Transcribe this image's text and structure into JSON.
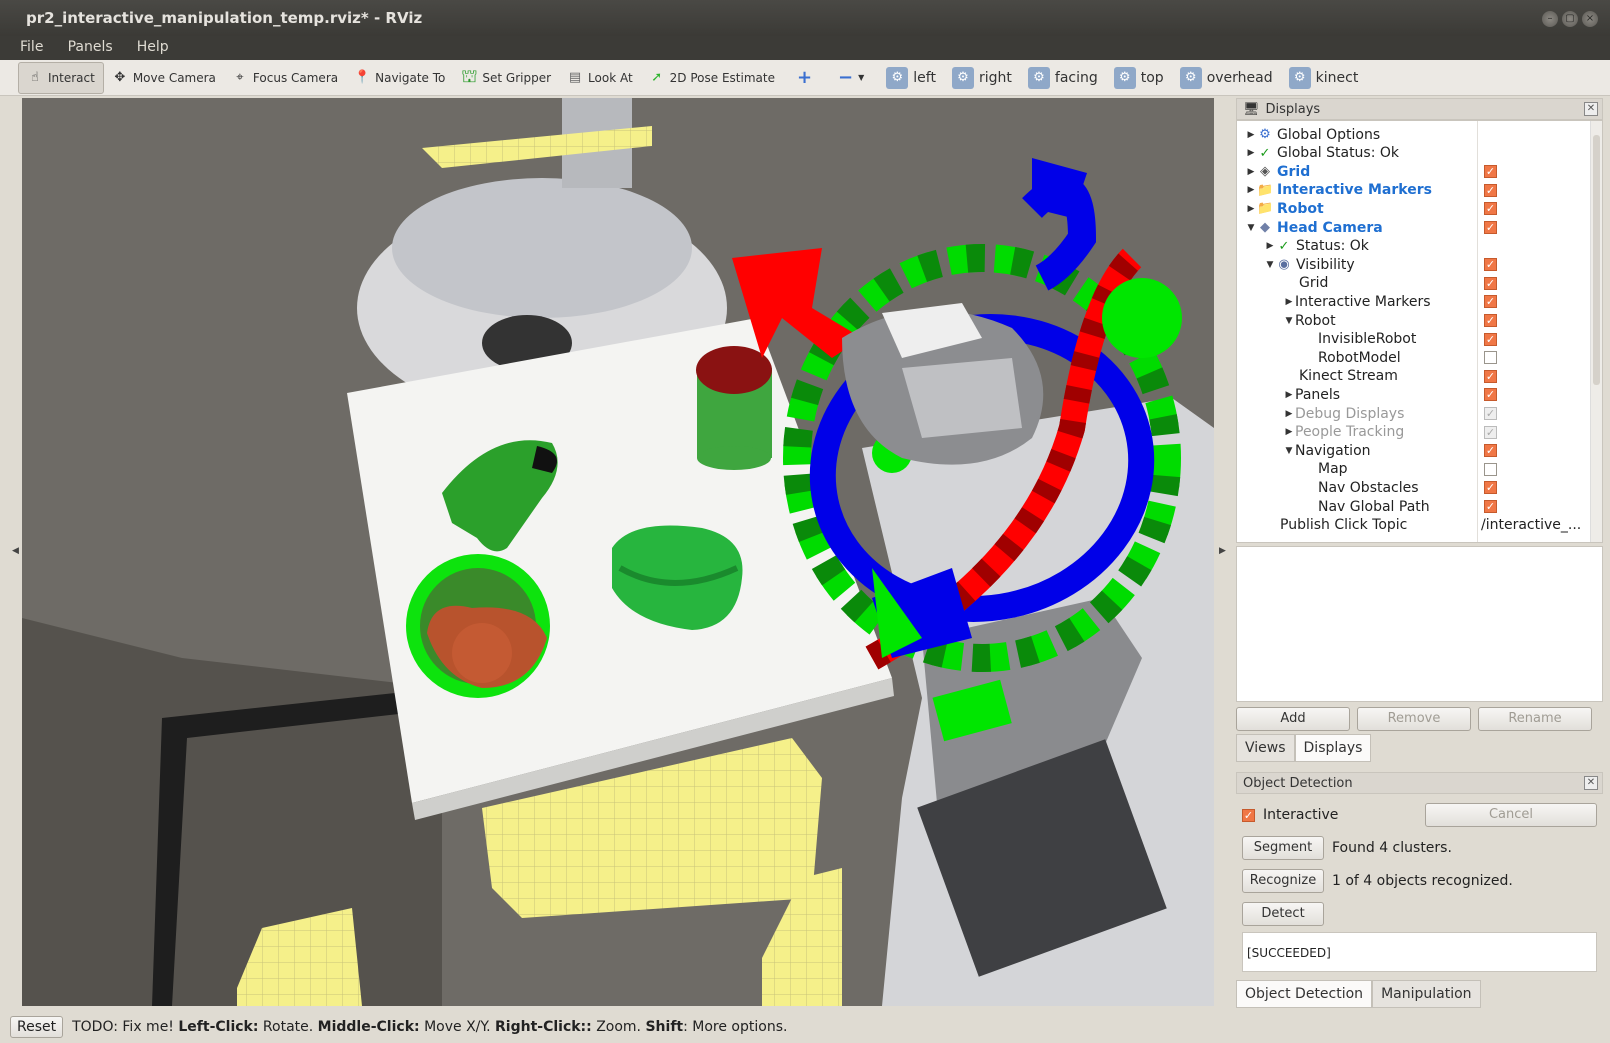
{
  "window": {
    "title": "pr2_interactive_manipulation_temp.rviz* - RViz",
    "controls": [
      "–",
      "▢",
      "×"
    ]
  },
  "menu": [
    "File",
    "Panels",
    "Help"
  ],
  "toolbar": {
    "tools": [
      {
        "label": "Interact",
        "icon": "hand-pointer-icon"
      },
      {
        "label": "Move Camera",
        "icon": "move-arrows-icon"
      },
      {
        "label": "Focus Camera",
        "icon": "crosshair-icon"
      },
      {
        "label": "Navigate To",
        "icon": "map-pin-icon"
      },
      {
        "label": "Set Gripper",
        "icon": "gripper-icon"
      },
      {
        "label": "Look At",
        "icon": "robot-head-icon"
      },
      {
        "label": "2D Pose Estimate",
        "icon": "green-arrow-icon"
      }
    ],
    "add_symbol": "+",
    "remove_symbol": "−",
    "views": [
      "left",
      "right",
      "facing",
      "top",
      "overhead",
      "kinect"
    ]
  },
  "displays_panel": {
    "title": "Displays",
    "rows": [
      {
        "label": "Global Options",
        "indent": 0,
        "arrow": "right",
        "icon": "gear-icon",
        "style": "normal",
        "check": null
      },
      {
        "label": "Global Status: Ok",
        "indent": 0,
        "arrow": "right",
        "icon": "check-icon",
        "style": "normal",
        "check": null
      },
      {
        "label": "Grid",
        "indent": 0,
        "arrow": "right",
        "icon": "grid-icon",
        "style": "blue",
        "check": "on"
      },
      {
        "label": "Interactive Markers",
        "indent": 0,
        "arrow": "right",
        "icon": "folder-icon",
        "style": "blue",
        "check": "on"
      },
      {
        "label": "Robot",
        "indent": 0,
        "arrow": "right",
        "icon": "folder-icon",
        "style": "blue",
        "check": "on"
      },
      {
        "label": "Head Camera",
        "indent": 0,
        "arrow": "down",
        "icon": "camera-diamond-icon",
        "style": "blue",
        "check": "on"
      },
      {
        "label": "Status: Ok",
        "indent": 1,
        "arrow": "right",
        "icon": "check-icon",
        "style": "normal",
        "check": null
      },
      {
        "label": "Visibility",
        "indent": 1,
        "arrow": "down",
        "icon": "eye-icon",
        "style": "normal",
        "check": "on"
      },
      {
        "label": "Grid",
        "indent": 2,
        "arrow": "",
        "icon": "",
        "style": "normal",
        "check": "on"
      },
      {
        "label": "Interactive Markers",
        "indent": 2,
        "arrow": "right",
        "icon": "",
        "style": "normal",
        "check": "on"
      },
      {
        "label": "Robot",
        "indent": 2,
        "arrow": "down",
        "icon": "",
        "style": "normal",
        "check": "on"
      },
      {
        "label": "InvisibleRobot",
        "indent": 3,
        "arrow": "",
        "icon": "",
        "style": "normal",
        "check": "on"
      },
      {
        "label": "RobotModel",
        "indent": 3,
        "arrow": "",
        "icon": "",
        "style": "normal",
        "check": "off"
      },
      {
        "label": "Kinect Stream",
        "indent": 2,
        "arrow": "",
        "icon": "",
        "style": "normal",
        "check": "on"
      },
      {
        "label": "Panels",
        "indent": 2,
        "arrow": "right",
        "icon": "",
        "style": "normal",
        "check": "on"
      },
      {
        "label": "Debug Displays",
        "indent": 2,
        "arrow": "right",
        "icon": "",
        "style": "gray",
        "check": "dim"
      },
      {
        "label": "People Tracking",
        "indent": 2,
        "arrow": "right",
        "icon": "",
        "style": "gray",
        "check": "dim"
      },
      {
        "label": "Navigation",
        "indent": 2,
        "arrow": "down",
        "icon": "",
        "style": "normal",
        "check": "on"
      },
      {
        "label": "Map",
        "indent": 3,
        "arrow": "",
        "icon": "",
        "style": "normal",
        "check": "off"
      },
      {
        "label": "Nav Obstacles",
        "indent": 3,
        "arrow": "",
        "icon": "",
        "style": "normal",
        "check": "on"
      },
      {
        "label": "Nav Global Path",
        "indent": 3,
        "arrow": "",
        "icon": "",
        "style": "normal",
        "check": "on"
      },
      {
        "label": "Publish Click Topic",
        "indent": 1,
        "arrow": "",
        "icon": "",
        "style": "normal",
        "check": null,
        "value": "/interactive_..."
      }
    ],
    "buttons": {
      "add": "Add",
      "remove": "Remove",
      "rename": "Rename"
    },
    "tabs": [
      "Views",
      "Displays"
    ],
    "active_tab": "Displays"
  },
  "object_detection": {
    "title": "Object Detection",
    "interactive_label": "Interactive",
    "interactive_checked": true,
    "cancel_label": "Cancel",
    "segment_label": "Segment",
    "segment_result": "Found 4 clusters.",
    "recognize_label": "Recognize",
    "recognize_result": "1 of 4 objects recognized.",
    "detect_label": "Detect",
    "status": "[SUCCEEDED]",
    "tabs": [
      "Object Detection",
      "Manipulation"
    ],
    "active_tab": "Object Detection"
  },
  "statusbar": {
    "reset": "Reset",
    "text_1": "TODO: Fix me! ",
    "bold_1": "Left-Click:",
    "text_2": " Rotate. ",
    "bold_2": "Middle-Click:",
    "text_3": " Move X/Y. ",
    "bold_3": "Right-Click::",
    "text_4": " Zoom. ",
    "bold_4": "Shift",
    "text_5": ": More options."
  },
  "colors": {
    "checkbox_on": "#f07746",
    "tree_blue": "#1f6fd1",
    "marker_red": "#ff0000",
    "marker_green": "#00e600",
    "marker_blue": "#0000e8",
    "nav_obstacles": "#f5f08a"
  }
}
